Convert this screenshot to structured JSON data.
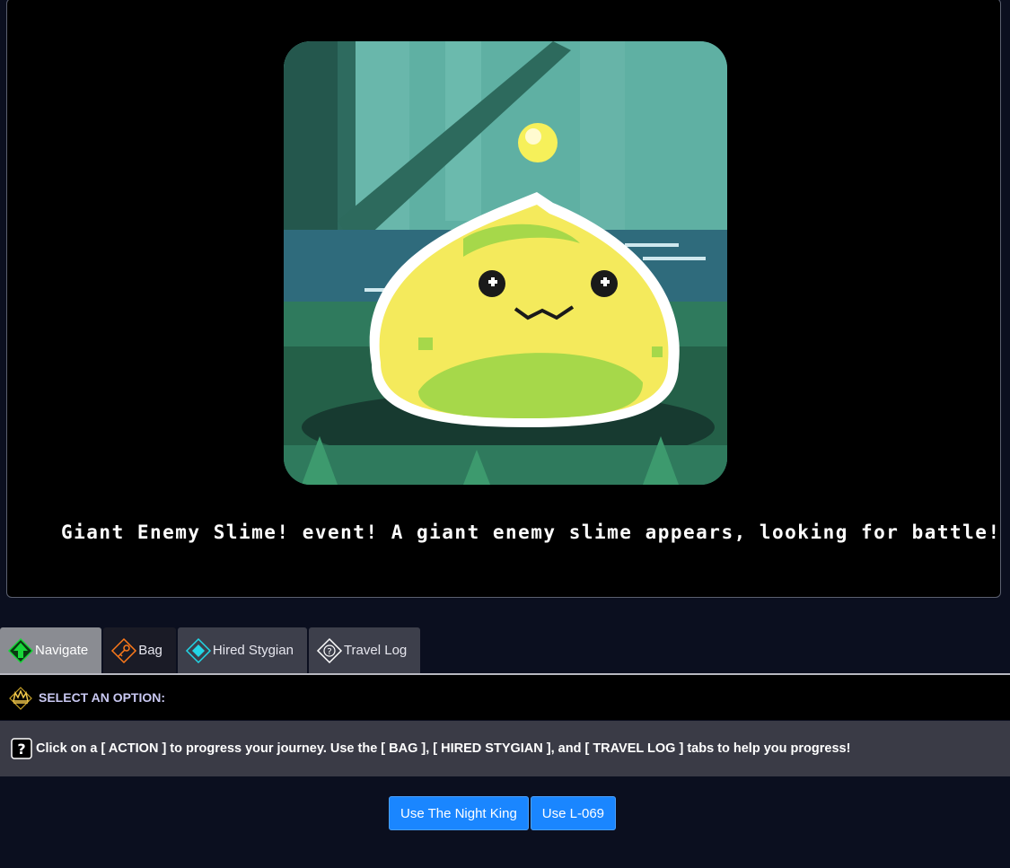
{
  "event": {
    "image_alt": "Giant enemy slime pixel art",
    "text": "Giant Enemy Slime! event! A giant enemy slime appears, looking for battle!"
  },
  "tabs": [
    {
      "label": "Navigate",
      "icon": "arrow-up-icon",
      "active": true
    },
    {
      "label": "Bag",
      "icon": "key-icon",
      "active": false
    },
    {
      "label": "Hired Stygian",
      "icon": "diamond-icon",
      "active": false
    },
    {
      "label": "Travel Log",
      "icon": "question-diamond-icon",
      "active": false
    }
  ],
  "prompt": {
    "label": "SELECT AN OPTION:",
    "icon": "crown-icon"
  },
  "help": {
    "icon": "question-icon",
    "text": "Click on a [ ACTION ] to progress your journey. Use the [ BAG ], [ HIRED STYGIAN ], and [ TRAVEL LOG ] tabs to help you progress!"
  },
  "actions": [
    {
      "label": "Use The Night King"
    },
    {
      "label": "Use L-069"
    }
  ],
  "colors": {
    "background": "#0b0f1f",
    "action_button": "#1a86ff",
    "prompt_text": "#c9c8f2",
    "navigate_icon": "#19d63a",
    "bag_icon": "#ff7a1a",
    "stygian_icon": "#22d6e6"
  }
}
